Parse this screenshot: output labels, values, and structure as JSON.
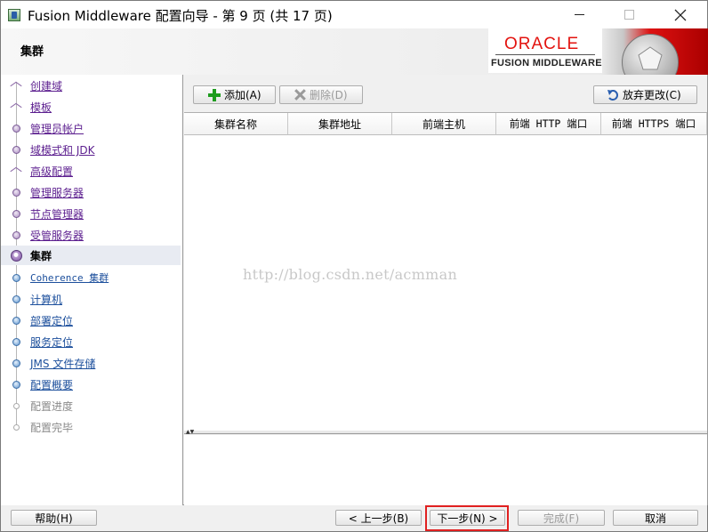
{
  "window": {
    "title": "Fusion Middleware 配置向导 - 第 9 页 (共 17 页)"
  },
  "header": {
    "page_heading": "集群",
    "logo_oracle": "ORACLE",
    "logo_product": "FUSION MIDDLEWARE"
  },
  "nav": {
    "items": [
      {
        "label": "创建域",
        "state": "visited"
      },
      {
        "label": "模板",
        "state": "visited"
      },
      {
        "label": "管理员帐户",
        "state": "visited"
      },
      {
        "label": "域模式和 JDK",
        "state": "visited"
      },
      {
        "label": "高级配置",
        "state": "visited"
      },
      {
        "label": "管理服务器",
        "state": "visited"
      },
      {
        "label": "节点管理器",
        "state": "visited"
      },
      {
        "label": "受管服务器",
        "state": "visited"
      },
      {
        "label": "集群",
        "state": "current"
      },
      {
        "label": "Coherence 集群",
        "state": "todo"
      },
      {
        "label": "计算机",
        "state": "todo"
      },
      {
        "label": "部署定位",
        "state": "todo"
      },
      {
        "label": "服务定位",
        "state": "todo"
      },
      {
        "label": "JMS 文件存储",
        "state": "todo"
      },
      {
        "label": "配置概要",
        "state": "todo"
      },
      {
        "label": "配置进度",
        "state": "disabled"
      },
      {
        "label": "配置完毕",
        "state": "disabled"
      }
    ]
  },
  "toolbar": {
    "add_label": "添加(A)",
    "delete_label": "删除(D)",
    "discard_label": "放弃更改(C)"
  },
  "table": {
    "columns": [
      "集群名称",
      "集群地址",
      "前端主机",
      "前端 HTTP 端口",
      "前端 HTTPS 端口"
    ],
    "rows": []
  },
  "watermark": "http://blog.csdn.net/acmman",
  "footer": {
    "help_label": "帮助(H)",
    "back_label": "< 上一步(B)",
    "next_label": "下一步(N) >",
    "finish_label": "完成(F)",
    "cancel_label": "取消"
  }
}
